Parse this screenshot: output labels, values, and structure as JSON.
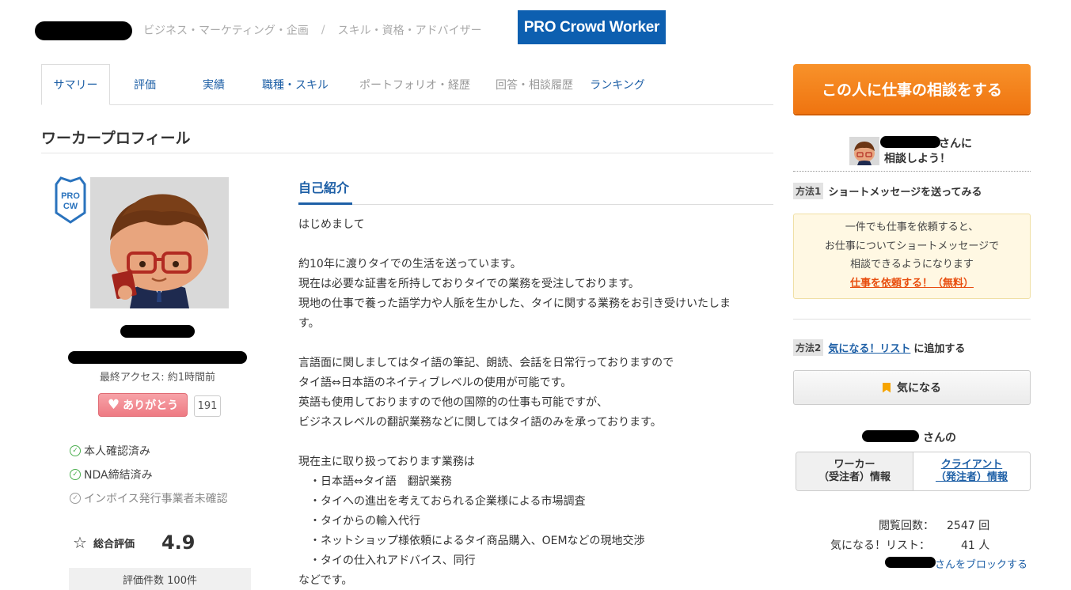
{
  "breadcrumb": {
    "item1": "ビジネス・マーケティング・企画",
    "separator": "/",
    "item2": "スキル・資格・アドバイザー"
  },
  "logo": {
    "text": "PRO Crowd Worker",
    "color": "#0d5fb0"
  },
  "tabs": [
    {
      "label": "サマリー"
    },
    {
      "label": "評価"
    },
    {
      "label": "実績"
    },
    {
      "label": "職種・スキル"
    },
    {
      "label": "ポートフォリオ・経歴"
    },
    {
      "label": "回答・相談履歴"
    },
    {
      "label": "ランキング"
    }
  ],
  "section_title": "ワーカープロフィール",
  "profile": {
    "pro_badge": "PRO CW",
    "last_access": "最終アクセス: 約1時間前",
    "thanks_label": "ありがとう",
    "thanks_count": "191",
    "verifications": [
      {
        "label": "本人確認済み"
      },
      {
        "label": "NDA締結済み"
      },
      {
        "label": "インボイス発行事業者未確認"
      }
    ],
    "rating_label": "総合評価",
    "rating_value": "4.9",
    "rating_count": "評価件数 100件"
  },
  "intro": {
    "heading": "自己紹介",
    "lines": [
      "はじめまして",
      "",
      "約10年に渡りタイでの生活を送っています。",
      "現在は必要な証書を所持しておりタイでの業務を受注しております。",
      "現地の仕事で養った語学力や人脈を生かした、タイに関する業務をお引き受けいたしま",
      "す。",
      "",
      "言語面に関しましてはタイ語の筆記、朗読、会話を日常行っておりますので",
      "タイ語⇔日本語のネイティブレベルの使用が可能です。",
      "英語も使用しておりますので他の国際的の仕事も可能ですが、",
      "ビジネスレベルの翻訳業務などに関してはタイ語のみを承っております。",
      "",
      "現在主に取り扱っております業務は",
      "　・日本語⇔タイ語　翻訳業務",
      "　・タイへの進出を考えておられる企業様による市場調査",
      "　・タイからの輸入代行",
      "　・ネットショップ様依頼によるタイ商品購入、OEMなどの現地交渉",
      "　・タイの仕入れアドバイス、同行",
      "などです。"
    ]
  },
  "sidebar": {
    "consult_button": "この人に仕事の相談をする",
    "san_ni": "さんに",
    "lets_consult": "相談しよう！",
    "method1_tag": "方法1",
    "method1_text": "ショートメッセージを送ってみる",
    "note_line1": "一件でも仕事を依頼すると、",
    "note_line2": "お仕事についてショートメッセージで",
    "note_line3": "相談できるようになります",
    "note_link": "仕事を依頼する！（無料）",
    "method2_tag": "方法2",
    "method2_link": "気になる！リスト",
    "method2_suffix": "に追加する",
    "fav_button": "気になる",
    "san_no": "さんの",
    "role_worker_line1": "ワーカー",
    "role_worker_line2": "（受注者）情報",
    "role_client_line1": "クライアント",
    "role_client_line2": "（発注者）情報",
    "views_label": "閲覧回数：",
    "views_value": "2547 回",
    "fav_list_label": "気になる！リスト：",
    "fav_list_value": "41 人",
    "block_link": "さんをブロックする"
  },
  "colors": {
    "link": "#1d5fa6",
    "consult_orange": "#ef7410",
    "thanks_pink": "#ee7a83",
    "note_bg": "#fff8e3",
    "note_link": "#e84e0f"
  }
}
